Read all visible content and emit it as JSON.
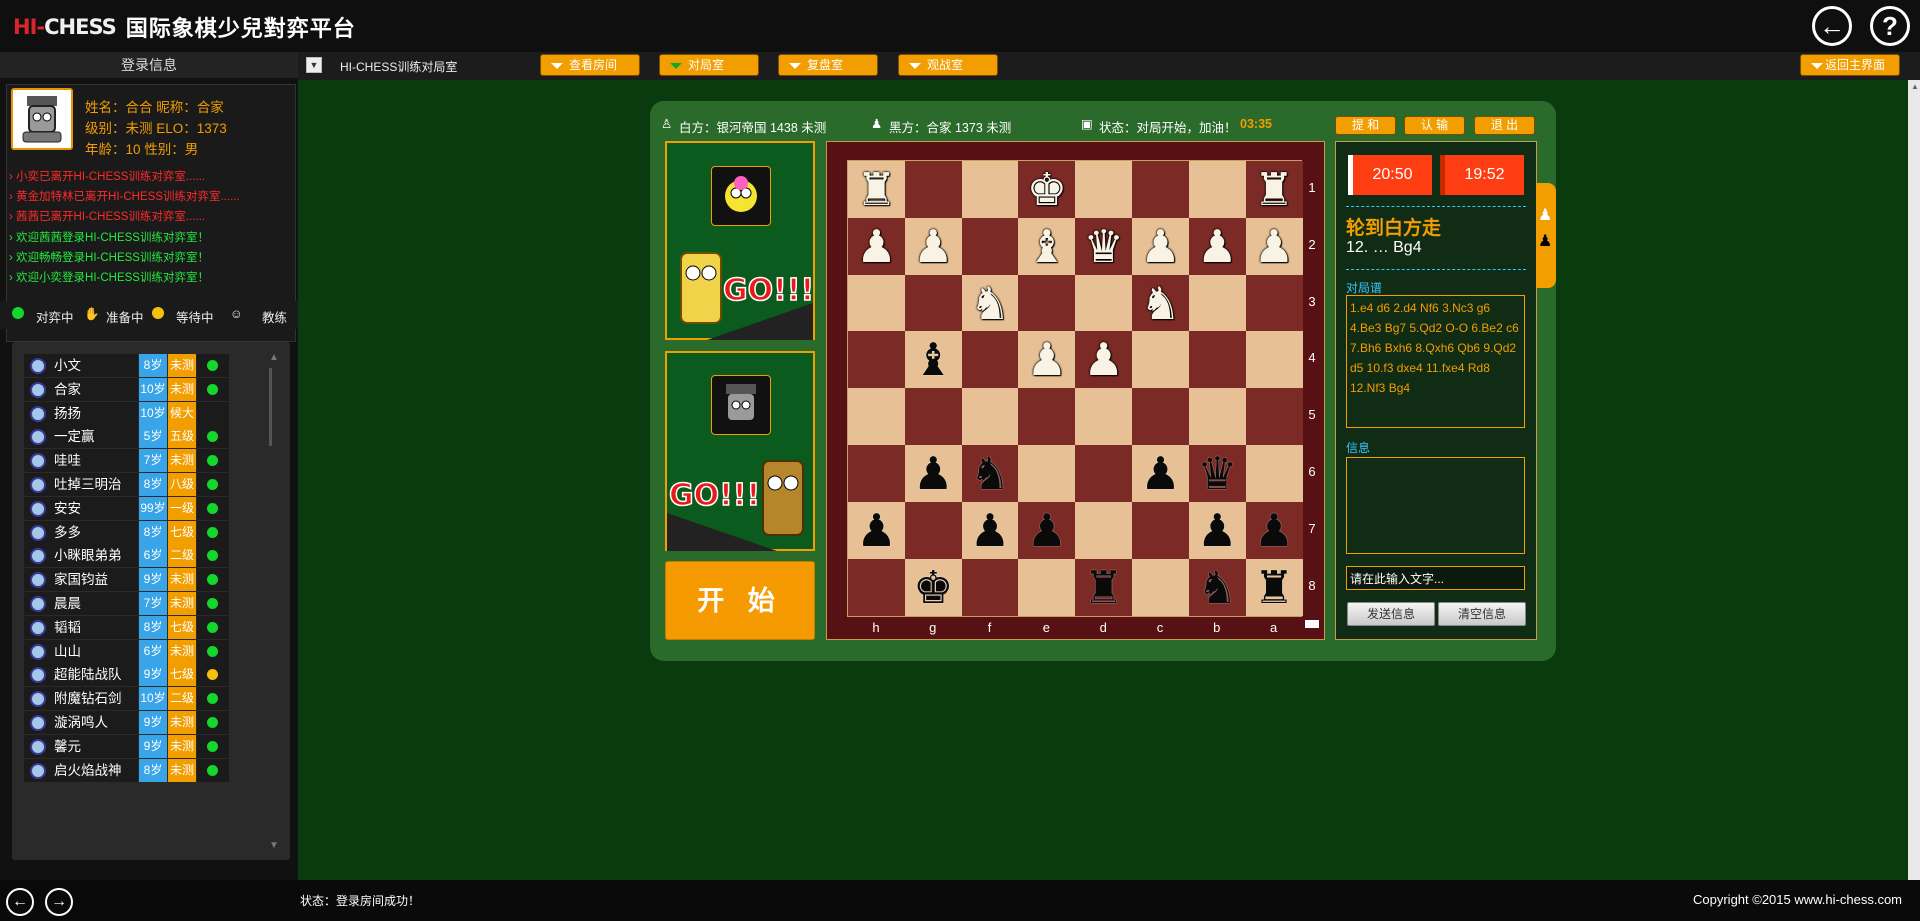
{
  "app": {
    "logo_hi": "HI-",
    "logo_chess": "CHESS",
    "logo_subtitle": "国际象棋少兒對弈平台",
    "back_icon": "arrow-left-icon",
    "help_icon": "question-icon"
  },
  "left": {
    "login_title": "登录信息",
    "name_line": "姓名：合合 昵称：合家",
    "level_line": "级别：未测 ELO：1373",
    "age_line": "年龄：10 性别：男",
    "messages": [
      {
        "text": "小奕已离开HI-CHESS训练对弈室......",
        "color": "#ff2a2a"
      },
      {
        "text": "黄金加特林已离开HI-CHESS训练对弈室......",
        "color": "#ff2a2a"
      },
      {
        "text": "茜茜已离开HI-CHESS训练对弈室......",
        "color": "#ff2a2a"
      },
      {
        "text": "欢迎茜茜登录HI-CHESS训练对弈室！",
        "color": "#25e83e"
      },
      {
        "text": "欢迎畅畅登录HI-CHESS训练对弈室！",
        "color": "#25e83e"
      },
      {
        "text": "欢迎小奕登录HI-CHESS训练对弈室！",
        "color": "#25e83e"
      }
    ],
    "legend": {
      "playing": "对弈中",
      "ready": "准备中",
      "waiting": "等待中",
      "coach": "教练"
    },
    "players": [
      {
        "name": "小文",
        "age": "8岁",
        "level": "未测",
        "status": "green"
      },
      {
        "name": "合家",
        "age": "10岁",
        "level": "未测",
        "status": "green"
      },
      {
        "name": "扬扬",
        "age": "10岁",
        "level": "候大",
        "status": ""
      },
      {
        "name": "一定赢",
        "age": "5岁",
        "level": "五级",
        "status": "green"
      },
      {
        "name": "哇哇",
        "age": "7岁",
        "level": "未测",
        "status": "green"
      },
      {
        "name": "吐掉三明治",
        "age": "8岁",
        "level": "八级",
        "status": "green"
      },
      {
        "name": "安安",
        "age": "99岁",
        "level": "一级",
        "status": "green"
      },
      {
        "name": "多多",
        "age": "8岁",
        "level": "七级",
        "status": "green"
      },
      {
        "name": "小眯眼弟弟",
        "age": "6岁",
        "level": "二级",
        "status": "green"
      },
      {
        "name": "家国钧益",
        "age": "9岁",
        "level": "未测",
        "status": "green"
      },
      {
        "name": "晨晨",
        "age": "7岁",
        "level": "未测",
        "status": "green"
      },
      {
        "name": "韬韬",
        "age": "8岁",
        "level": "七级",
        "status": "green"
      },
      {
        "name": "山山",
        "age": "6岁",
        "level": "未测",
        "status": "green"
      },
      {
        "name": "超能陆战队",
        "age": "9岁",
        "level": "七级",
        "status": "yellow"
      },
      {
        "name": "附魔钻石剑",
        "age": "10岁",
        "level": "二级",
        "status": "green"
      },
      {
        "name": "漩涡鸣人",
        "age": "9岁",
        "level": "未测",
        "status": "green"
      },
      {
        "name": "馨元",
        "age": "9岁",
        "level": "未测",
        "status": "green"
      },
      {
        "name": "启火焰战神",
        "age": "8岁",
        "level": "未测",
        "status": "green"
      }
    ]
  },
  "nav": {
    "room_title": "HI-CHESS训练对局室",
    "view_room": "查看房间",
    "match_room": "对局室",
    "review_room": "复盘室",
    "watch_room": "观战室",
    "return_main": "返回主界面"
  },
  "game": {
    "white_player": "白方：银河帝国 1438 未测",
    "black_player": "黑方：合家 1373 未测",
    "status": "状态：对局开始，加油！",
    "elapsed": "03:35",
    "draw_btn": "提 和",
    "resign_btn": "认 输",
    "exit_btn": "退 出",
    "start_btn": "开 始",
    "clock_white": "20:50",
    "clock_black": "19:52",
    "turn": "轮到白方走",
    "last_move": "12. … Bg4",
    "moves_title": "对局谱",
    "moves_text": "1.e4 d6 2.d4 Nf6 3.Nc3 g6 4.Be3 Bg7 5.Qd2 O-O 6.Be2 c6 7.Bh6 Bxh6 8.Qxh6 Qb6 9.Qd2 d5 10.f3 dxe4 11.fxe4 Rd8 12.Nf3 Bg4",
    "info_title": "信息",
    "chat_placeholder": "请在此输入文字...",
    "send_btn": "发送信息",
    "clear_btn": "清空信息",
    "files": [
      "h",
      "g",
      "f",
      "e",
      "d",
      "c",
      "b",
      "a"
    ],
    "ranks": [
      "1",
      "2",
      "3",
      "4",
      "5",
      "6",
      "7",
      "8"
    ],
    "board": [
      [
        "wR",
        "",
        "",
        "wK",
        "",
        "",
        "",
        "wR"
      ],
      [
        "wP",
        "wP",
        "",
        "wB",
        "wQ",
        "wP",
        "wP",
        "wP"
      ],
      [
        "",
        "",
        "wN",
        "",
        "",
        "wN",
        "",
        ""
      ],
      [
        "",
        "bB",
        "",
        "wP",
        "wP",
        "",
        "",
        ""
      ],
      [
        "",
        "",
        "",
        "",
        "",
        "",
        "",
        ""
      ],
      [
        "",
        "bP",
        "bN",
        "",
        "",
        "bP",
        "bQ",
        ""
      ],
      [
        "bP",
        "",
        "bP",
        "bP",
        "",
        "",
        "bP",
        "bP"
      ],
      [
        "",
        "bK",
        "",
        "",
        "bR",
        "",
        "bN",
        "bR"
      ]
    ]
  },
  "footer": {
    "status": "状态：登录房间成功！",
    "copyright": "Copyright ©2015 www.hi-chess.com"
  }
}
